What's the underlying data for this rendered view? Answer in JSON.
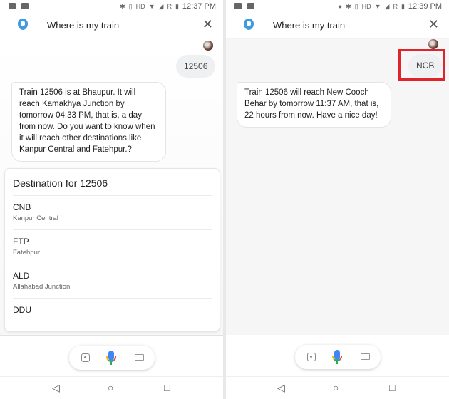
{
  "left": {
    "status": {
      "time": "12:37 PM",
      "icons": [
        "image-icon",
        "activity-icon",
        "bluetooth-icon",
        "vibrate-icon",
        "hd-icon",
        "wifi-icon",
        "signal-icon",
        "battery-icon"
      ],
      "hd": "HD",
      "roaming": "R"
    },
    "header": {
      "title": "Where is my train",
      "close": "✕"
    },
    "user_message": "12506",
    "assistant_message": "Train 12506 is at Bhaupur. It will reach Kamakhya Junction by tomorrow 04:33 PM, that is, a day from now. Do you want to know when it will reach other destinations like Kanpur Central and Fatehpur.?",
    "card": {
      "title": "Destination for 12506",
      "items": [
        {
          "code": "CNB",
          "name": "Kanpur Central"
        },
        {
          "code": "FTP",
          "name": "Fatehpur"
        },
        {
          "code": "ALD",
          "name": "Allahabad Junction"
        },
        {
          "code": "DDU",
          "name": ""
        }
      ]
    }
  },
  "right": {
    "status": {
      "time": "12:39 PM",
      "icons": [
        "image-icon",
        "activity-icon",
        "location-icon",
        "bluetooth-icon",
        "vibrate-icon",
        "hd-icon",
        "wifi-icon",
        "signal-icon",
        "battery-icon"
      ],
      "hd": "HD",
      "roaming": "R"
    },
    "header": {
      "title": "Where is my train",
      "close": "✕"
    },
    "user_message": "NCB",
    "assistant_message": "Train 12506 will reach New Cooch Behar by tomorrow 11:37 AM, that is, 22 hours from now. Have a nice day!",
    "highlight_color": "#e0242b"
  },
  "nav": {
    "back": "◁",
    "home": "○",
    "recents": "□"
  }
}
